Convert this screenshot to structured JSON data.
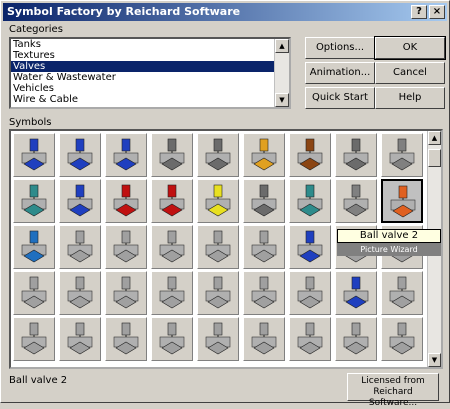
{
  "window": {
    "title": "Symbol Factory by Reichard Software",
    "help_glyph": "?",
    "close_glyph": "×"
  },
  "categories": {
    "label": "Categories",
    "items": [
      "Tanks",
      "Textures",
      "Valves",
      "Water & Wastewater",
      "Vehicles",
      "Wire & Cable"
    ],
    "selected_index": 2
  },
  "buttons": {
    "options": "Options...",
    "ok": "OK",
    "animation": "Animation...",
    "cancel": "Cancel",
    "quick_start": "Quick Start",
    "help": "Help"
  },
  "symbols": {
    "label": "Symbols",
    "selected_name": "Ball valve 2",
    "tooltip_title": "Ball valve 2",
    "tooltip_sub": "Picture Wizard"
  },
  "status": {
    "text": "Ball valve 2"
  },
  "license_button": {
    "line1": "Licensed from",
    "line2": "Reichard Software..."
  },
  "colors": {
    "titlebar_start": "#0a246a",
    "titlebar_end": "#a6caf0",
    "selection": "#0a246a",
    "tooltip_bg": "#ffffe1"
  }
}
